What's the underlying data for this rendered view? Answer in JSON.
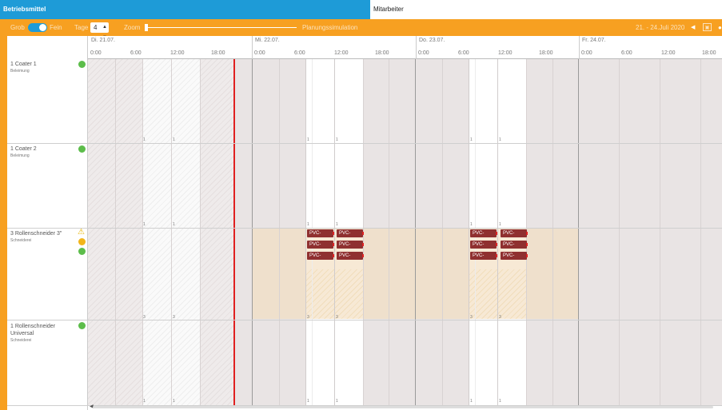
{
  "tabs": {
    "betriebsmittel": "Betriebsmittel",
    "mitarbeiter": "Mitarbeiter"
  },
  "toolbar": {
    "grob": "Grob",
    "fein": "Fein",
    "tage_label": "Tage",
    "tage_value": "4",
    "zoom_label": "Zoom",
    "zoom_level": 0.0,
    "planungssimulation": "Planungssimulation",
    "date_range": "21. - 24.Juli 2020",
    "colors": {
      "bar": "#f7a021",
      "tab_active": "#1e9bd7"
    },
    "icons": [
      "prev-arrow-icon",
      "calendar-icon"
    ]
  },
  "days": [
    {
      "label": "Di. 21.07.",
      "hours": [
        "0:00",
        "6:00",
        "12:00",
        "18:00"
      ]
    },
    {
      "label": "Mi. 22.07.",
      "hours": [
        "0:00",
        "6:00",
        "12:00",
        "18:00"
      ]
    },
    {
      "label": "Do. 23.07.",
      "hours": [
        "0:00",
        "6:00",
        "12:00",
        "18:00"
      ]
    },
    {
      "label": "Fr. 24.07.",
      "hours": [
        "0:00",
        "6:00",
        "12:00",
        "18:00"
      ]
    }
  ],
  "resources": [
    {
      "name": "1 Coater 1",
      "group": "Beleimung",
      "status": [
        "green"
      ]
    },
    {
      "name": "1 Coater 2",
      "group": "Beleimung",
      "status": [
        "green"
      ]
    },
    {
      "name": "3 Rollenschneider 3\"",
      "group": "Schneiderei",
      "status": [
        "warning",
        "yellow",
        "green"
      ]
    },
    {
      "name": "1 Rollenschneider Universal",
      "group": "Schneiderei",
      "status": [
        "green"
      ]
    }
  ],
  "task_label": "PVC-",
  "cell_count_markers": [
    "1",
    "3"
  ],
  "status_colors": {
    "green": "#5cbd4a",
    "yellow": "#f2b51a",
    "warning": "#e8b400",
    "now_line": "#e02020",
    "task": "#8f3030"
  }
}
